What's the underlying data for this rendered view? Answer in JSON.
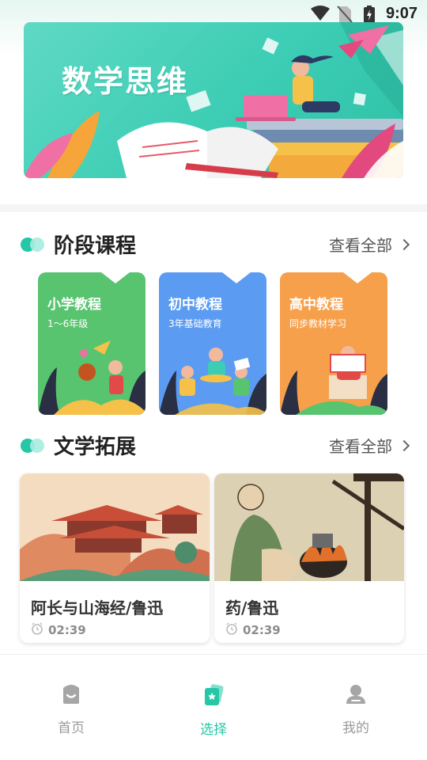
{
  "status_bar": {
    "time": "9:07"
  },
  "banner": {
    "title": "数学思维"
  },
  "sections": {
    "stage": {
      "title": "阶段课程",
      "view_all": "查看全部",
      "cards": [
        {
          "title": "小学教程",
          "subtitle": "1～6年级",
          "color": "#58c46f"
        },
        {
          "title": "初中教程",
          "subtitle": "3年基础教育",
          "color": "#5b9cf2"
        },
        {
          "title": "高中教程",
          "subtitle": "同步教材学习",
          "color": "#f7a04b"
        }
      ]
    },
    "literature": {
      "title": "文学拓展",
      "view_all": "查看全部",
      "cards": [
        {
          "title": "阿长与山海经/鲁迅",
          "duration": "02:39"
        },
        {
          "title": "药/鲁迅",
          "duration": "02:39"
        }
      ]
    }
  },
  "bottom_nav": {
    "items": [
      {
        "label": "首页",
        "icon": "home-icon",
        "active": false
      },
      {
        "label": "选择",
        "icon": "cards-icon",
        "active": true
      },
      {
        "label": "我的",
        "icon": "user-icon",
        "active": false
      }
    ]
  },
  "colors": {
    "accent": "#25c7a6",
    "inactive": "#9a9a9a"
  }
}
